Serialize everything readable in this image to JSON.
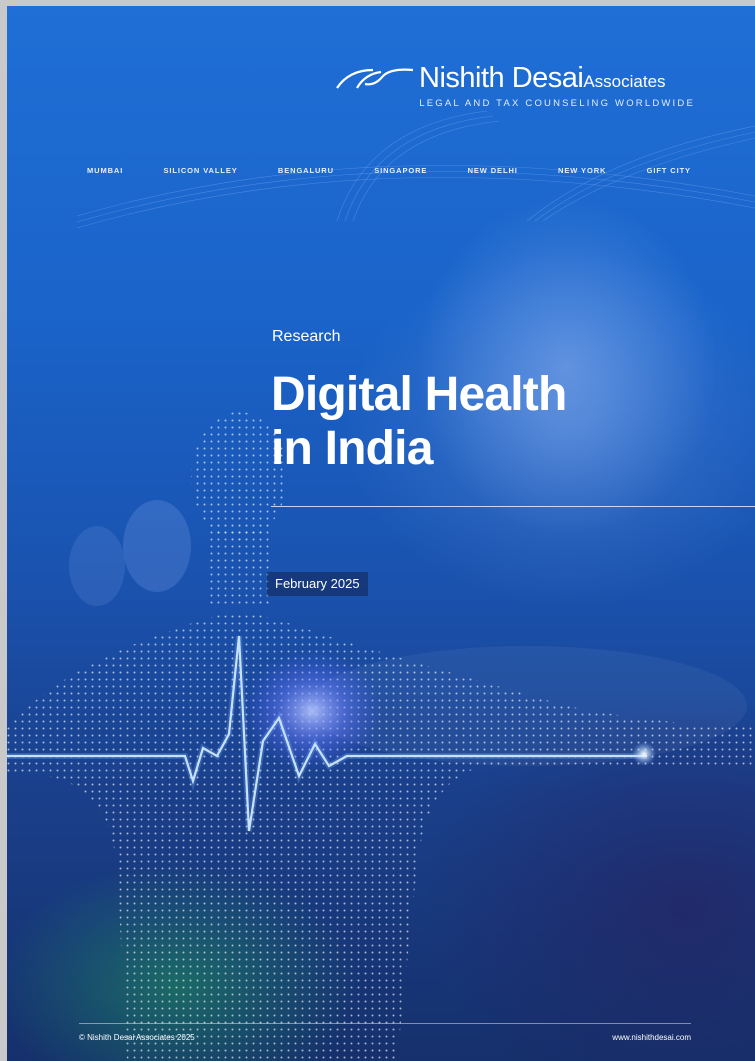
{
  "header": {
    "brand_name": "Nishith Desai",
    "brand_suffix": "Associates",
    "tagline": "LEGAL AND TAX COUNSELING WORLDWIDE",
    "logo_icon": "swoosh-logo-icon"
  },
  "locations": [
    "MUMBAI",
    "SILICON VALLEY",
    "BENGALURU",
    "SINGAPORE",
    "NEW DELHI",
    "NEW YORK",
    "GIFT CITY"
  ],
  "cover": {
    "kicker": "Research",
    "title_line1": "Digital Health",
    "title_line2": "in India",
    "date": "February 2025"
  },
  "footer": {
    "copyright": "© Nishith Desai Associates 2025",
    "website": "www.nishithdesai.com"
  },
  "colors": {
    "background_top": "#1f6fd6",
    "background_bottom": "#15306c",
    "text": "#ffffff",
    "pulse": "#cfe6ff"
  }
}
